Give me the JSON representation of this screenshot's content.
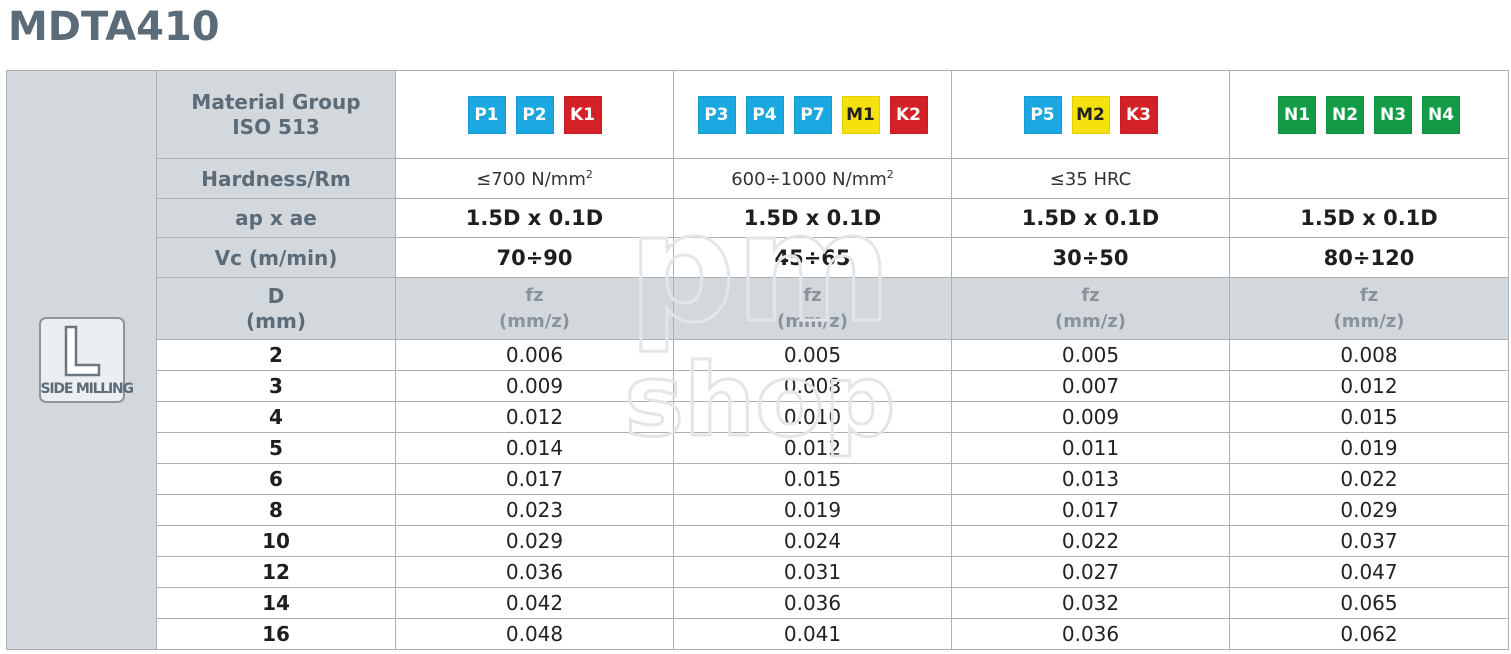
{
  "title": "MDTA410",
  "side_icon": {
    "label": "SIDE MILLING",
    "icon": "side-milling-icon"
  },
  "colors": {
    "P": "#1ba8e0",
    "M": "#f5e10e",
    "K": "#d42027",
    "N": "#139b47"
  },
  "labels": {
    "material_group_line1": "Material Group",
    "material_group_line2": "ISO 513",
    "hardness": "Hardness/Rm",
    "apae": "ap x ae",
    "vc": "Vc (m/min)",
    "d_line1": "D",
    "d_line2": "(mm)"
  },
  "columns": [
    {
      "badges": [
        {
          "text": "P1",
          "color": "#1ba8e0"
        },
        {
          "text": "P2",
          "color": "#1ba8e0"
        },
        {
          "text": "K1",
          "color": "#d42027"
        }
      ],
      "hardness_value": "≤700 N/mm",
      "hardness_sup": "2",
      "apae": "1.5D x 0.1D",
      "vc": "70÷90",
      "fz_line1": "fz",
      "fz_line2": "(mm/z)"
    },
    {
      "badges": [
        {
          "text": "P3",
          "color": "#1ba8e0"
        },
        {
          "text": "P4",
          "color": "#1ba8e0"
        },
        {
          "text": "P7",
          "color": "#1ba8e0"
        },
        {
          "text": "M1",
          "color": "#f5e10e"
        },
        {
          "text": "K2",
          "color": "#d42027"
        }
      ],
      "hardness_value": "600÷1000 N/mm",
      "hardness_sup": "2",
      "apae": "1.5D x 0.1D",
      "vc": "45÷65",
      "fz_line1": "fz",
      "fz_line2": "(mm/z)"
    },
    {
      "badges": [
        {
          "text": "P5",
          "color": "#1ba8e0"
        },
        {
          "text": "M2",
          "color": "#f5e10e"
        },
        {
          "text": "K3",
          "color": "#d42027"
        }
      ],
      "hardness_value": "≤35 HRC",
      "hardness_sup": "",
      "apae": "1.5D x 0.1D",
      "vc": "30÷50",
      "fz_line1": "fz",
      "fz_line2": "(mm/z)"
    },
    {
      "badges": [
        {
          "text": "N1",
          "color": "#139b47"
        },
        {
          "text": "N2",
          "color": "#139b47"
        },
        {
          "text": "N3",
          "color": "#139b47"
        },
        {
          "text": "N4",
          "color": "#139b47"
        }
      ],
      "hardness_value": "",
      "hardness_sup": "",
      "apae": "1.5D x 0.1D",
      "vc": "80÷120",
      "fz_line1": "fz",
      "fz_line2": "(mm/z)"
    }
  ],
  "rows": [
    {
      "d": "2",
      "fz": [
        "0.006",
        "0.005",
        "0.005",
        "0.008"
      ]
    },
    {
      "d": "3",
      "fz": [
        "0.009",
        "0.008",
        "0.007",
        "0.012"
      ]
    },
    {
      "d": "4",
      "fz": [
        "0.012",
        "0.010",
        "0.009",
        "0.015"
      ]
    },
    {
      "d": "5",
      "fz": [
        "0.014",
        "0.012",
        "0.011",
        "0.019"
      ]
    },
    {
      "d": "6",
      "fz": [
        "0.017",
        "0.015",
        "0.013",
        "0.022"
      ]
    },
    {
      "d": "8",
      "fz": [
        "0.023",
        "0.019",
        "0.017",
        "0.029"
      ]
    },
    {
      "d": "10",
      "fz": [
        "0.029",
        "0.024",
        "0.022",
        "0.037"
      ]
    },
    {
      "d": "12",
      "fz": [
        "0.036",
        "0.031",
        "0.027",
        "0.047"
      ]
    },
    {
      "d": "14",
      "fz": [
        "0.042",
        "0.036",
        "0.032",
        "0.065"
      ]
    },
    {
      "d": "16",
      "fz": [
        "0.048",
        "0.041",
        "0.036",
        "0.062"
      ]
    }
  ],
  "watermark": {
    "line1": "pm",
    "line2": "shop"
  }
}
